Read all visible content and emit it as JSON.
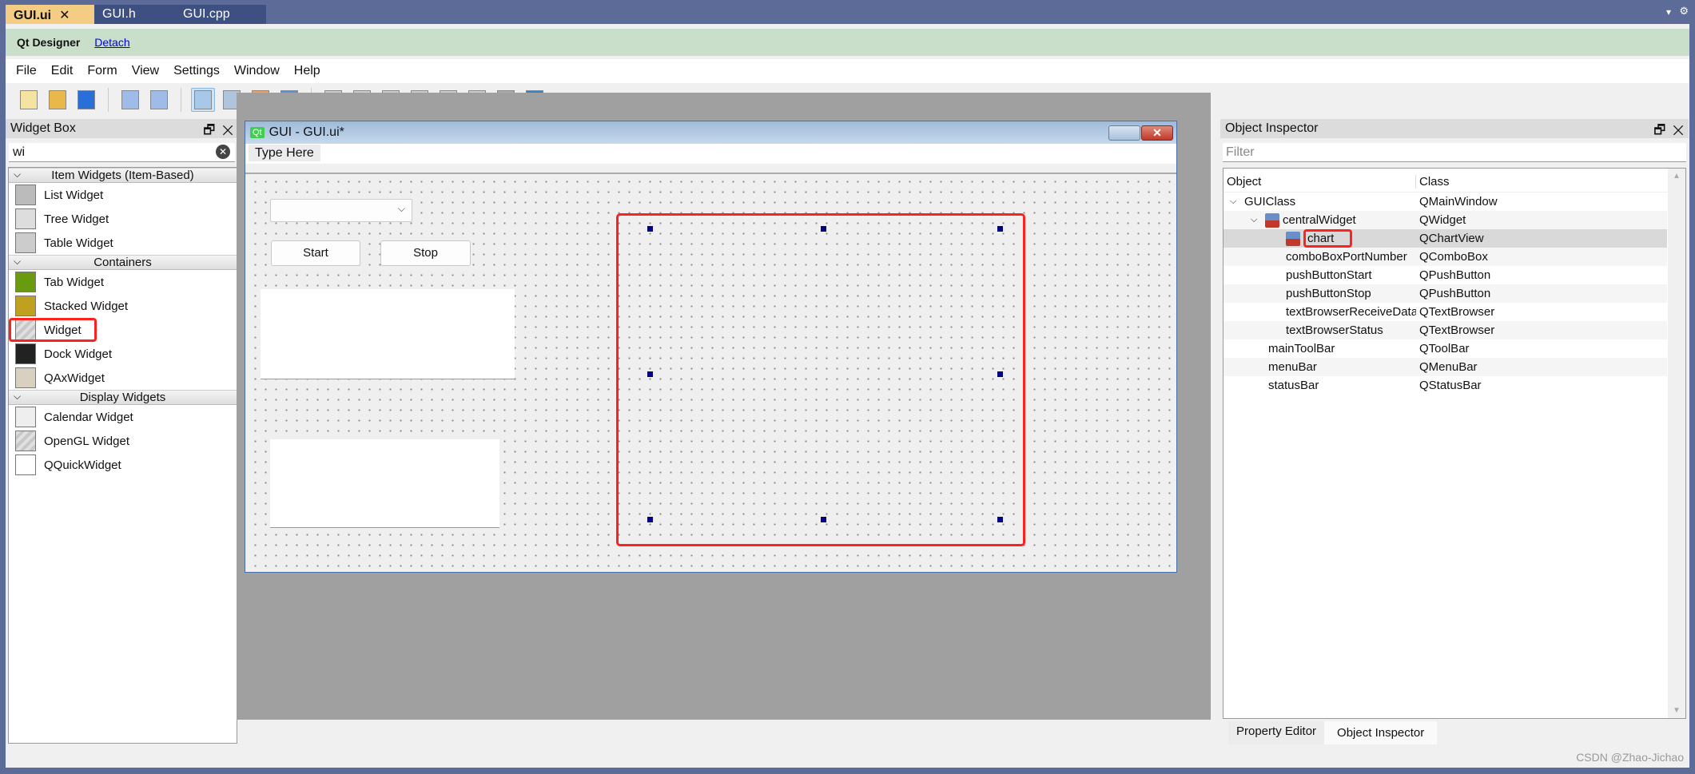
{
  "doc_tabs": [
    {
      "label": "GUI.ui",
      "active": true
    },
    {
      "label": "GUI.h"
    },
    {
      "label": "GUI.cpp"
    }
  ],
  "designer_bar": {
    "title": "Qt Designer",
    "detach": "Detach"
  },
  "menu": [
    "File",
    "Edit",
    "Form",
    "View",
    "Settings",
    "Window",
    "Help"
  ],
  "toolbar_icons": [
    "new-file-icon",
    "open-folder-icon",
    "save-icon",
    "send-to-back-icon",
    "bring-to-front-icon",
    "edit-widgets-icon",
    "edit-signals-slots-icon",
    "edit-buddies-icon",
    "edit-tab-order-icon",
    "layout-horizontal-icon",
    "layout-vertical-icon",
    "layout-horizontal-splitter-icon",
    "layout-vertical-splitter-icon",
    "layout-grid-icon",
    "layout-form-icon",
    "break-layout-icon",
    "adjust-size-icon"
  ],
  "widget_box": {
    "title": "Widget Box",
    "search_value": "wi",
    "categories": [
      {
        "label": "Item Widgets (Item-Based)",
        "items": [
          "List Widget",
          "Tree Widget",
          "Table Widget"
        ]
      },
      {
        "label": "Containers",
        "items": [
          "Tab Widget",
          "Stacked Widget",
          "Widget",
          "Dock Widget",
          "QAxWidget"
        ]
      },
      {
        "label": "Display Widgets",
        "items": [
          "Calendar Widget",
          "OpenGL Widget",
          "QQuickWidget"
        ]
      }
    ]
  },
  "form": {
    "title": "GUI - GUI.ui*",
    "menu_placeholder": "Type Here",
    "buttons": {
      "start": "Start",
      "stop": "Stop"
    }
  },
  "object_inspector": {
    "title": "Object Inspector",
    "filter_placeholder": "Filter",
    "columns": [
      "Object",
      "Class"
    ],
    "rows": [
      {
        "object": "GUIClass",
        "class": "QMainWindow",
        "level": 0,
        "expanded": true
      },
      {
        "object": "centralWidget",
        "class": "QWidget",
        "level": 1,
        "expanded": true,
        "icon": true
      },
      {
        "object": "chart",
        "class": "QChartView",
        "level": 2,
        "icon": true,
        "selected": true
      },
      {
        "object": "comboBoxPortNumber",
        "class": "QComboBox",
        "level": 2
      },
      {
        "object": "pushButtonStart",
        "class": "QPushButton",
        "level": 2
      },
      {
        "object": "pushButtonStop",
        "class": "QPushButton",
        "level": 2
      },
      {
        "object": "textBrowserReceiveData",
        "class": "QTextBrowser",
        "level": 2
      },
      {
        "object": "textBrowserStatus",
        "class": "QTextBrowser",
        "level": 2
      },
      {
        "object": "mainToolBar",
        "class": "QToolBar",
        "level": 1
      },
      {
        "object": "menuBar",
        "class": "QMenuBar",
        "level": 1
      },
      {
        "object": "statusBar",
        "class": "QStatusBar",
        "level": 1
      }
    ]
  },
  "bottom_tabs": [
    "Property Editor",
    "Object Inspector"
  ],
  "watermark": "CSDN @Zhao-Jichao",
  "colors": {
    "highlight": "#ff2020",
    "active_tab": "#f5cc84",
    "frame": "#5d6b99"
  }
}
